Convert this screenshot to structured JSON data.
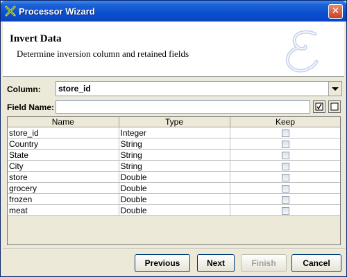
{
  "window": {
    "title": "Processor Wizard",
    "close_glyph": "✕"
  },
  "header": {
    "title": "Invert Data",
    "subtitle": "Determine inversion column and retained fields"
  },
  "form": {
    "column_label": "Column:",
    "column_value": "store_id",
    "field_name_label": "Field Name:",
    "field_name_value": "",
    "check_all_glyph": "☑"
  },
  "table": {
    "columns": [
      "Name",
      "Type",
      "Keep"
    ],
    "rows": [
      {
        "name": "store_id",
        "type": "Integer",
        "keep": false
      },
      {
        "name": "Country",
        "type": "String",
        "keep": false
      },
      {
        "name": "State",
        "type": "String",
        "keep": false
      },
      {
        "name": "City",
        "type": "String",
        "keep": false
      },
      {
        "name": "store",
        "type": "Double",
        "keep": false
      },
      {
        "name": "grocery",
        "type": "Double",
        "keep": false
      },
      {
        "name": "frozen",
        "type": "Double",
        "keep": false
      },
      {
        "name": "meat",
        "type": "Double",
        "keep": false
      }
    ]
  },
  "buttons": {
    "previous": "Previous",
    "next": "Next",
    "finish": "Finish",
    "cancel": "Cancel"
  },
  "icons": {
    "title_icon": "wizard-icon",
    "logo": "script-e-logo"
  },
  "colors": {
    "titlebar": "#0a4fd0",
    "background": "#ece9d8",
    "logo_tint": "#c8d4ec"
  }
}
